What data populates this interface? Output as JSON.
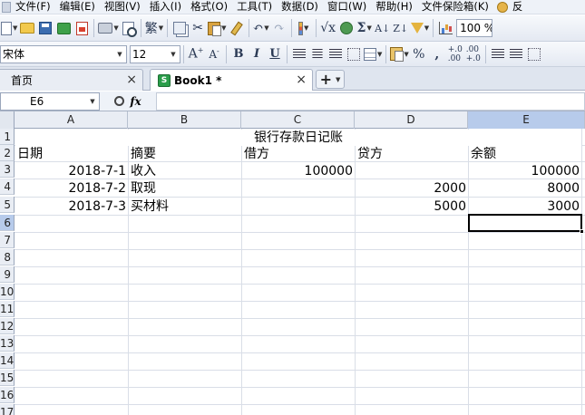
{
  "menubar": {
    "items": [
      "文件(F)",
      "编辑(E)",
      "视图(V)",
      "插入(I)",
      "格式(O)",
      "工具(T)",
      "数据(D)",
      "窗口(W)",
      "帮助(H)",
      "文件保险箱(K)",
      "反"
    ]
  },
  "toolbar": {
    "zoom": "100 %"
  },
  "format_bar": {
    "font_name": "宋体",
    "font_size": "12",
    "currency_symbol": "%",
    "comma_symbol": ","
  },
  "tabs": {
    "home_label": "首页",
    "book_label": "Book1 *",
    "close_glyph": "×",
    "add_glyph": "+"
  },
  "formula_bar": {
    "cell_ref": "E6",
    "fx_label": "fx",
    "content": ""
  },
  "sheet": {
    "columns": [
      "A",
      "B",
      "C",
      "D",
      "E"
    ],
    "row_numbers": [
      "1",
      "2",
      "3",
      "4",
      "5",
      "6",
      "7",
      "8",
      "9",
      "10",
      "11",
      "12",
      "13",
      "14",
      "15",
      "16",
      "17"
    ],
    "title": "银行存款日记账",
    "headers": [
      "日期",
      "摘要",
      "借方",
      "贷方",
      "余额"
    ],
    "rows": [
      {
        "date": "2018-7-1",
        "summary": "收入",
        "debit": "100000",
        "credit": "",
        "balance": "100000"
      },
      {
        "date": "2018-7-2",
        "summary": "取现",
        "debit": "",
        "credit": "2000",
        "balance": "8000"
      },
      {
        "date": "2018-7-3",
        "summary": "买材料",
        "debit": "",
        "credit": "5000",
        "balance": "3000"
      }
    ],
    "selected_column": "E",
    "selected_row": "6"
  },
  "colors": {
    "selection_header": "#b7cbeb",
    "toolbar_bg": "#e4e9f2"
  }
}
